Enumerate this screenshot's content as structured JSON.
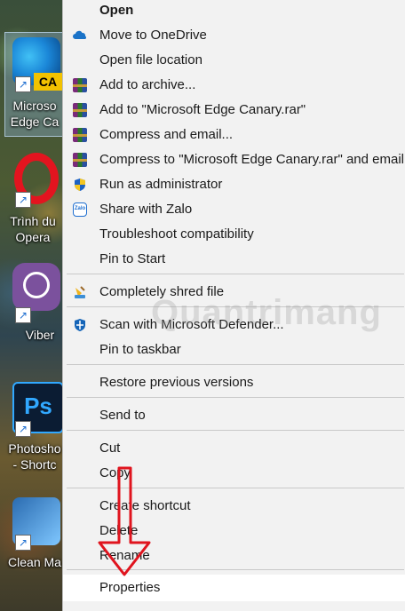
{
  "desktop": {
    "items": [
      {
        "label_lines": [
          "Microso",
          "Edge Ca"
        ],
        "badge": "CA"
      },
      {
        "label_lines": [
          "Trình du",
          "Opera"
        ]
      },
      {
        "label_lines": [
          "Viber"
        ]
      },
      {
        "label_lines": [
          "Photosho",
          "- Shortc"
        ],
        "badge": "Ps"
      },
      {
        "label_lines": [
          "Clean Ma"
        ]
      }
    ]
  },
  "menu": {
    "items": [
      {
        "label": "Open",
        "bold": true
      },
      {
        "label": "Move to OneDrive",
        "icon": "onedrive-cloud-icon"
      },
      {
        "label": "Open file location"
      },
      {
        "label": "Add to archive...",
        "icon": "winrar-icon"
      },
      {
        "label": "Add to \"Microsoft Edge Canary.rar\"",
        "icon": "winrar-icon"
      },
      {
        "label": "Compress and email...",
        "icon": "winrar-icon"
      },
      {
        "label": "Compress to \"Microsoft Edge Canary.rar\" and email",
        "icon": "winrar-icon"
      },
      {
        "label": "Run as administrator",
        "icon": "uac-shield-icon"
      },
      {
        "label": "Share with Zalo",
        "icon": "zalo-icon",
        "icon_text": "Zalo"
      },
      {
        "label": "Troubleshoot compatibility"
      },
      {
        "label": "Pin to Start"
      },
      {
        "label": "Completely shred file",
        "icon": "shredder-icon"
      },
      {
        "label": "Scan with Microsoft Defender...",
        "icon": "defender-icon"
      },
      {
        "label": "Pin to taskbar"
      },
      {
        "label": "Restore previous versions"
      },
      {
        "label": "Send to"
      },
      {
        "label": "Cut"
      },
      {
        "label": "Copy"
      },
      {
        "label": "Create shortcut"
      },
      {
        "label": "Delete"
      },
      {
        "label": "Rename"
      },
      {
        "label": "Properties",
        "highlighted": true
      }
    ]
  },
  "watermark": "Quantrimang",
  "colors": {
    "arrow": "#e0141e",
    "menu_bg": "#f2f2f2",
    "highlight": "#ffffff"
  }
}
